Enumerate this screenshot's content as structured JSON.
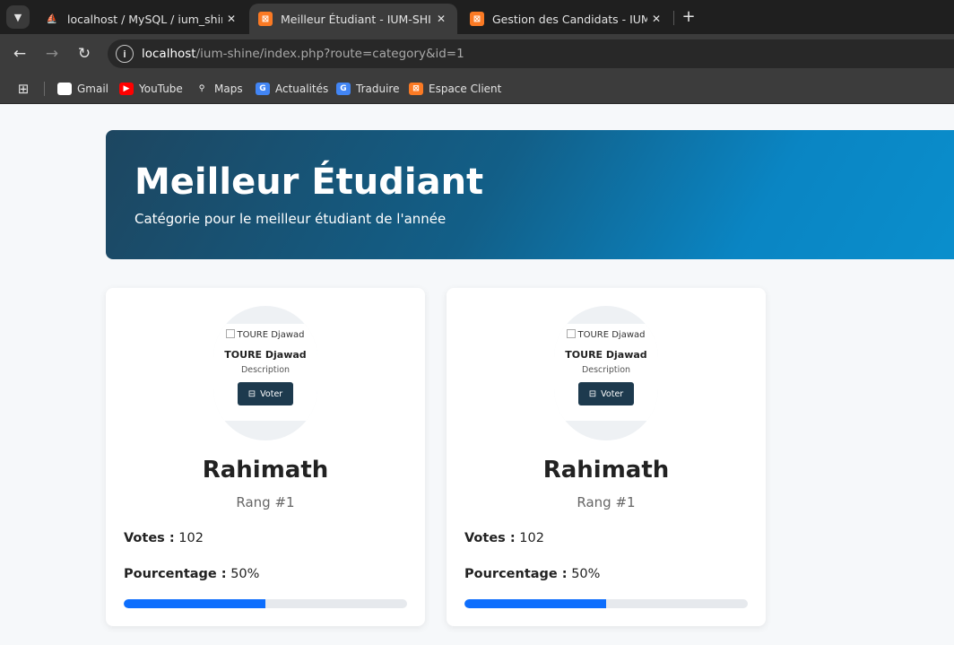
{
  "browser": {
    "tabs": [
      {
        "title": "localhost / MySQL / ium_shine / ",
        "close": "✕",
        "icon": "phpmyadmin-icon"
      },
      {
        "title": "Meilleur Étudiant - IUM-SHINE",
        "close": "✕",
        "icon": "xampp-icon"
      },
      {
        "title": "Gestion des Candidats - IUM-SHINE",
        "close": "✕",
        "icon": "xampp-icon"
      }
    ],
    "url_host": "localhost",
    "url_path": "/ium-shine/index.php?route=category&id=1",
    "bookmarks": [
      {
        "label": "Gmail",
        "icon": "gmail-icon"
      },
      {
        "label": "YouTube",
        "icon": "youtube-icon"
      },
      {
        "label": "Maps",
        "icon": "maps-icon"
      },
      {
        "label": "Actualités",
        "icon": "news-icon"
      },
      {
        "label": "Traduire",
        "icon": "translate-icon"
      },
      {
        "label": "Espace Client",
        "icon": "xampp-icon"
      }
    ]
  },
  "hero": {
    "title": "Meilleur Étudiant",
    "subtitle": "Catégorie pour le meilleur étudiant de l'année"
  },
  "cards": [
    {
      "image_alt": "TOURE Djawad",
      "candidate_name": "TOURE Djawad",
      "description": "Description",
      "vote_label": "Voter",
      "name": "Rahimath",
      "rank": "Rang #1",
      "votes_label": "Votes :",
      "votes_value": "102",
      "percent_label": "Pourcentage :",
      "percent_value": "50%",
      "progress": 0.5
    },
    {
      "image_alt": "TOURE Djawad",
      "candidate_name": "TOURE Djawad",
      "description": "Description",
      "vote_label": "Voter",
      "name": "Rahimath",
      "rank": "Rang #1",
      "votes_label": "Votes :",
      "votes_value": "102",
      "percent_label": "Pourcentage :",
      "percent_value": "50%",
      "progress": 0.5
    }
  ],
  "colors": {
    "accent": "#0d6efd",
    "vote_button": "#1d3a4e",
    "hero_start": "#1d4660",
    "hero_end": "#0a8fcd"
  }
}
